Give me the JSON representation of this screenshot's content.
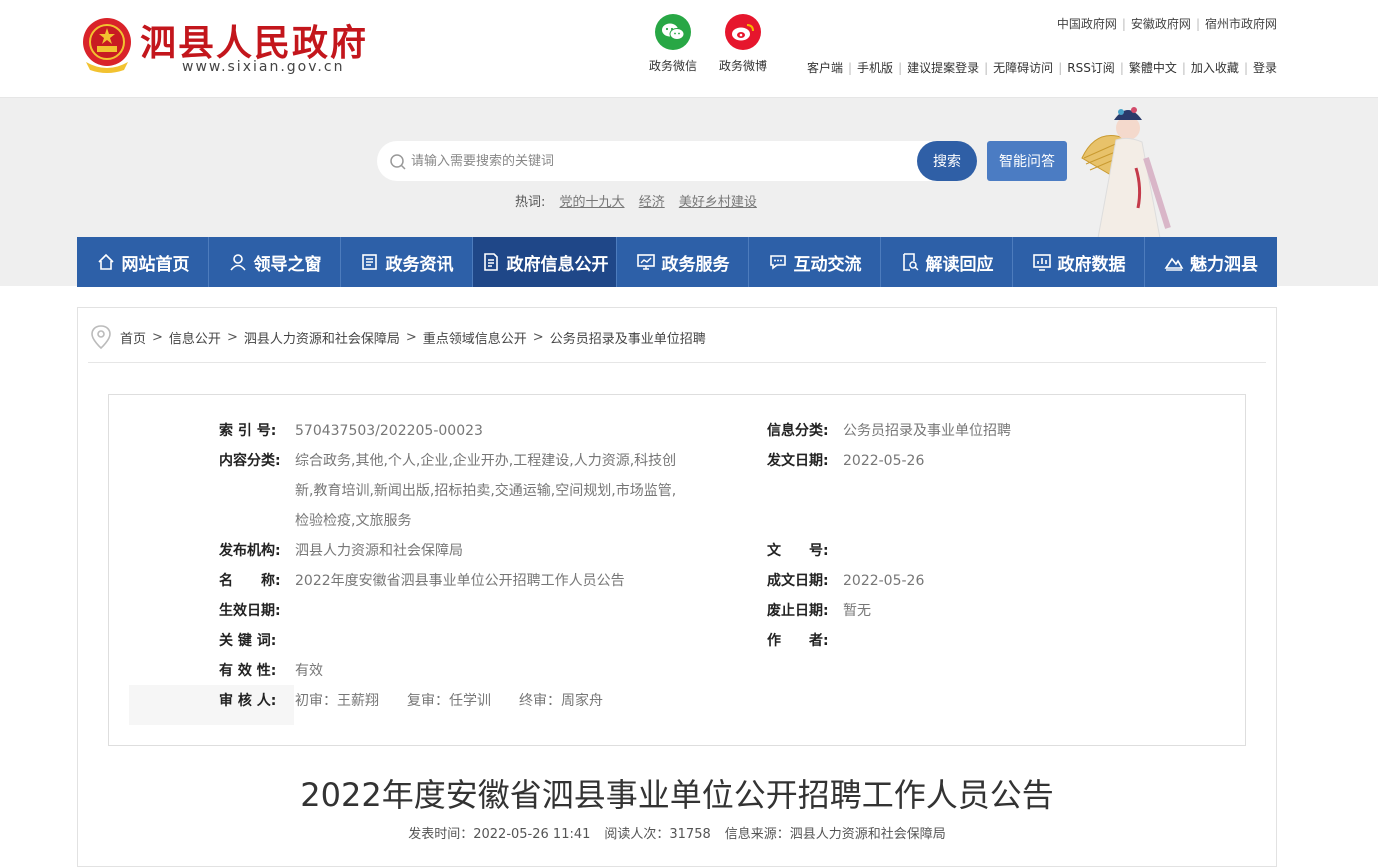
{
  "header": {
    "site_title": "泗县人民政府",
    "site_domain": "www.sixian.gov.cn",
    "social": [
      {
        "label": "政务微信",
        "icon": "wechat-icon",
        "color": "#28a745"
      },
      {
        "label": "政务微博",
        "icon": "weibo-icon",
        "color": "#e6162d"
      }
    ],
    "top_links": [
      "中国政府网",
      "安徽政府网",
      "宿州市政府网"
    ],
    "tool_links": [
      "客户端",
      "手机版",
      "建议提案登录",
      "无障碍访问",
      "RSS订阅",
      "繁體中文",
      "加入收藏",
      "登录"
    ]
  },
  "search": {
    "placeholder": "请输入需要搜索的关键词",
    "button": "搜索",
    "ai_button": "智能问答",
    "hot_label": "热词:",
    "hot_words": [
      "党的十九大",
      "经济",
      "美好乡村建设"
    ]
  },
  "nav": [
    {
      "label": "网站首页",
      "icon": "home-icon"
    },
    {
      "label": "领导之窗",
      "icon": "person-icon"
    },
    {
      "label": "政务资讯",
      "icon": "news-icon"
    },
    {
      "label": "政府信息公开",
      "icon": "document-icon",
      "active": true
    },
    {
      "label": "政务服务",
      "icon": "monitor-icon"
    },
    {
      "label": "互动交流",
      "icon": "chat-icon"
    },
    {
      "label": "解读回应",
      "icon": "search-doc-icon"
    },
    {
      "label": "政府数据",
      "icon": "chart-icon"
    },
    {
      "label": "魅力泗县",
      "icon": "mountain-icon"
    }
  ],
  "breadcrumb": [
    "首页",
    "信息公开",
    "泗县人力资源和社会保障局",
    "重点领域信息公开",
    "公务员招录及事业单位招聘"
  ],
  "meta": {
    "index_label": "索 引 号:",
    "index_value": "570437503/202205-00023",
    "category_label": "信息分类:",
    "category_value": "公务员招录及事业单位招聘",
    "content_type_label": "内容分类:",
    "content_type_value": "综合政务,其他,个人,企业,企业开办,工程建设,人力资源,科技创新,教育培训,新闻出版,招标拍卖,交通运输,空间规划,市场监管,检验检疫,文旅服务",
    "issue_date_label": "发文日期:",
    "issue_date_value": "2022-05-26",
    "publisher_label": "发布机构:",
    "publisher_value": "泗县人力资源和社会保障局",
    "doc_no_label": "文　　号:",
    "doc_no_value": "",
    "name_label": "名　　称:",
    "name_value": "2022年度安徽省泗县事业单位公开招聘工作人员公告",
    "written_date_label": "成文日期:",
    "written_date_value": "2022-05-26",
    "effective_label": "生效日期:",
    "effective_value": "",
    "abolish_label": "废止日期:",
    "abolish_value": "暂无",
    "keywords_label": "关 键 词:",
    "keywords_value": "",
    "author_label": "作　　者:",
    "author_value": "",
    "validity_label": "有 效 性:",
    "validity_value": "有效",
    "reviewer_label": "审 核 人:",
    "reviewer_value": "初审：王薪翔　　复审：任学训　　终审：周家舟"
  },
  "article": {
    "title": "2022年度安徽省泗县事业单位公开招聘工作人员公告",
    "publish_time": "发表时间：2022-05-26 11:41",
    "read_count": "阅读人次：31758",
    "source": "信息来源：泗县人力资源和社会保障局"
  }
}
